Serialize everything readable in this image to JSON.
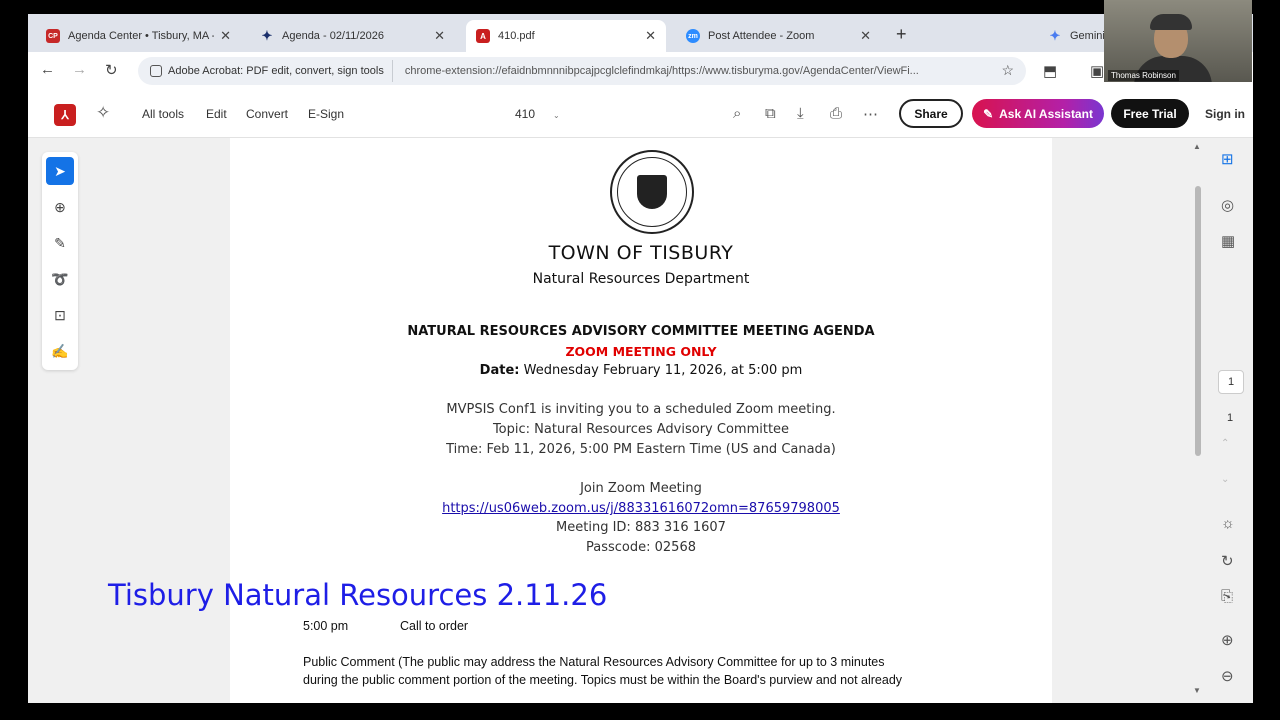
{
  "browser": {
    "tabs": [
      {
        "label": "Agenda Center • Tisbury, MA -",
        "icon": "CP",
        "active": false
      },
      {
        "label": "Agenda - 02/11/2026",
        "icon": "person",
        "active": false
      },
      {
        "label": "410.pdf",
        "icon": "pdf",
        "active": true
      },
      {
        "label": "Post Attendee - Zoom",
        "icon": "zm",
        "active": false
      },
      {
        "label": "Gemini",
        "icon": "star",
        "active": false
      }
    ],
    "new_tab": "+",
    "extension_chip": "Adobe Acrobat: PDF edit, convert, sign tools",
    "url": "chrome-extension://efaidnbmnnnibpcajpcglclefindmkaj/https://www.tisburyma.gov/AgendaCenter/ViewFi..."
  },
  "acrobat": {
    "menu": [
      "All tools",
      "Edit",
      "Convert",
      "E-Sign"
    ],
    "page_label": "410",
    "share": "Share",
    "ask_ai": "Ask AI Assistant",
    "free_trial": "Free Trial",
    "sign_in": "Sign in"
  },
  "document": {
    "town": "TOWN OF TISBURY",
    "department": "Natural Resources Department",
    "agenda_title": "NATURAL RESOURCES ADVISORY COMMITTEE MEETING AGENDA",
    "zoom_only": "ZOOM MEETING ONLY",
    "date_label": "Date:",
    "date_value": " Wednesday February 11, 2026, at 5:00 pm",
    "inviting": "MVPSIS Conf1 is inviting you to a scheduled Zoom meeting.",
    "topic": "Topic: Natural Resources Advisory Committee",
    "time": "Time: Feb 11, 2026, 5:00 PM Eastern Time (US and Canada)",
    "join": "Join Zoom Meeting",
    "link": "https://us06web.zoom.us/j/88331616072omn=87659798005",
    "meeting_id": "Meeting ID: 883 316 1607",
    "passcode": "Passcode: 02568",
    "item_time": "5:00 pm",
    "item_desc": "Call to order",
    "public_comment_1": "Public Comment (The public may address the Natural Resources Advisory Committee for up to 3 minutes",
    "public_comment_2": "during the public comment portion of the meeting.  Topics must be within the Board's purview and not already"
  },
  "overlay": {
    "title": "Tisbury Natural Resources 2.11.26"
  },
  "right_rail": {
    "page_current": "1",
    "page_total": "1"
  },
  "video": {
    "participant_name": "Thomas Robinson"
  },
  "colors": {
    "accent_blue": "#1473e6",
    "acrobat_red": "#c91f1f",
    "zoom_only_red": "#e00000",
    "overlay_blue": "#1e1ee6"
  }
}
